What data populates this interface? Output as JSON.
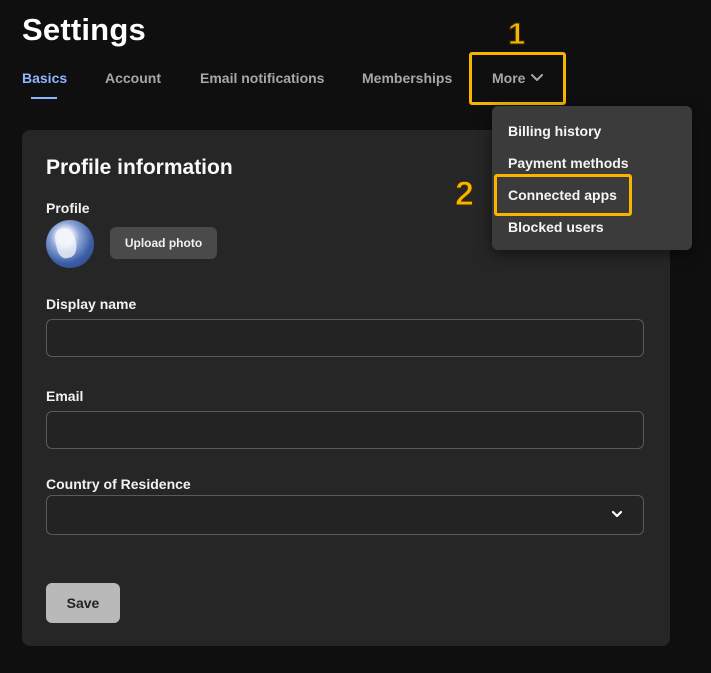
{
  "page_title": "Settings",
  "tabs": [
    {
      "label": "Basics",
      "active": true
    },
    {
      "label": "Account",
      "active": false
    },
    {
      "label": "Email notifications",
      "active": false
    },
    {
      "label": "Memberships",
      "active": false
    },
    {
      "label": "More",
      "active": false
    }
  ],
  "more_menu": {
    "items": [
      "Billing history",
      "Payment methods",
      "Connected apps",
      "Blocked users"
    ]
  },
  "annotations": {
    "step_1": "1",
    "step_2": "2",
    "highlight_color": "#f7b500"
  },
  "profile_card": {
    "title": "Profile information",
    "profile_label": "Profile",
    "upload_button": "Upload photo",
    "display_name_label": "Display name",
    "display_name_value": "",
    "email_label": "Email",
    "email_value": "",
    "country_label": "Country of Residence",
    "country_value": "",
    "save_button": "Save"
  },
  "colors": {
    "background": "#0f0f0f",
    "card": "#262626",
    "accent": "#8fb7ff",
    "dropdown": "#3b3b3b"
  },
  "icons": {
    "more_chevron": "chevron-down-icon",
    "select_chevron": "chevron-down-icon"
  }
}
